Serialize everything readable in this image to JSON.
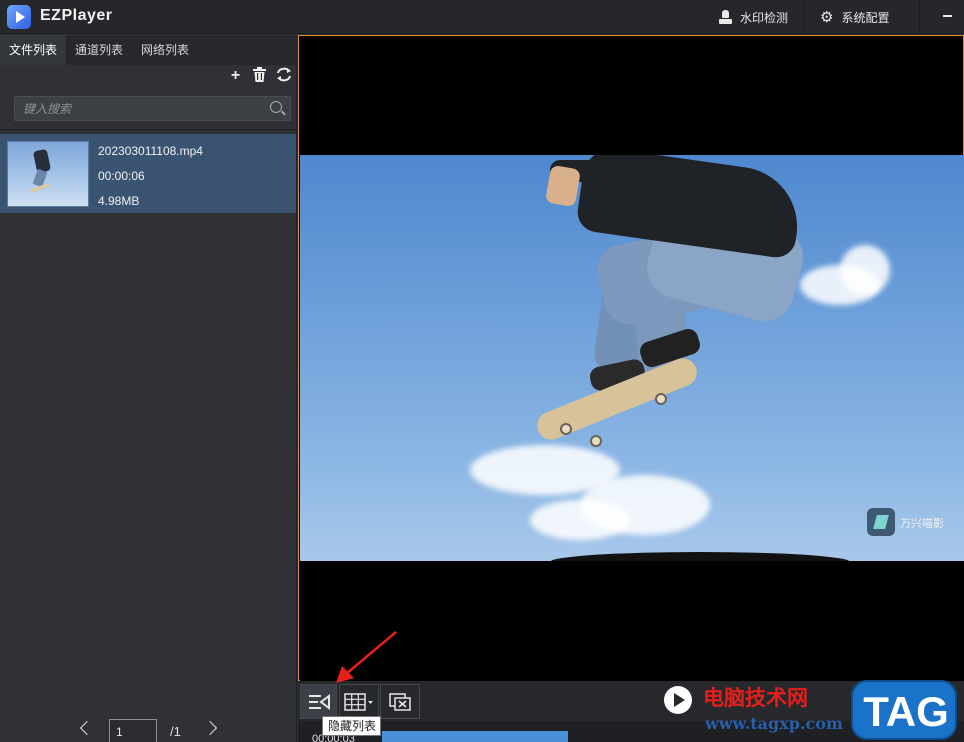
{
  "app": {
    "title": "EZPlayer"
  },
  "titlebar": {
    "watermark_label": "水印检测",
    "settings_label": "系统配置"
  },
  "tabs": [
    {
      "label": "文件列表"
    },
    {
      "label": "通道列表"
    },
    {
      "label": "网络列表"
    }
  ],
  "search": {
    "placeholder": "键入搜索"
  },
  "files": [
    {
      "name": "202303011108.mp4",
      "duration": "00:00:06",
      "size": "4.98MB"
    }
  ],
  "pager": {
    "current": "1",
    "total": "/1"
  },
  "video": {
    "watermark": "万兴喵影"
  },
  "controls": {
    "tooltip": "隐藏列表"
  },
  "progress": {
    "time": "00:00:03",
    "fraction": 0.28
  },
  "overlay": {
    "site_name": "电脑技术网",
    "site_url": "www.tagxp.com",
    "tag": "TAG"
  }
}
